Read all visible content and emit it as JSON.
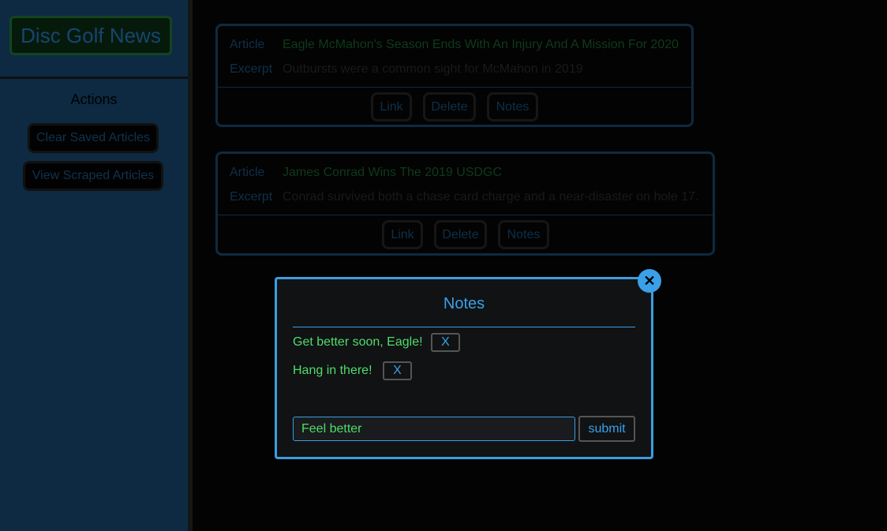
{
  "brand": {
    "title": "Disc Golf News"
  },
  "sidebar": {
    "actions_title": "Actions",
    "buttons": [
      {
        "label": "Clear Saved Articles"
      },
      {
        "label": "View Scraped Articles"
      }
    ]
  },
  "articles": [
    {
      "article_label": "Article",
      "title": "Eagle McMahon's Season Ends With An Injury And A Mission For 2020",
      "excerpt_label": "Excerpt",
      "excerpt": "Outbursts were a common sight for McMahon in 2019",
      "buttons": {
        "link": "Link",
        "delete": "Delete",
        "notes": "Notes"
      }
    },
    {
      "article_label": "Article",
      "title": "James Conrad Wins The 2019 USDGC",
      "excerpt_label": "Excerpt",
      "excerpt": "Conrad survived both a chase card charge and a near-disaster on hole 17.",
      "buttons": {
        "link": "Link",
        "delete": "Delete",
        "notes": "Notes"
      }
    }
  ],
  "modal": {
    "title": "Notes",
    "close_icon": "close-icon",
    "notes": [
      {
        "text": "Get better soon, Eagle!",
        "delete_label": "X"
      },
      {
        "text": "Hang in there!",
        "delete_label": "X"
      }
    ],
    "input_value": "Feel better",
    "submit_label": "submit"
  },
  "colors": {
    "accent_blue": "#3aa0e8",
    "note_green": "#4fdc6a",
    "sidebar_bg": "#0d2a42"
  }
}
